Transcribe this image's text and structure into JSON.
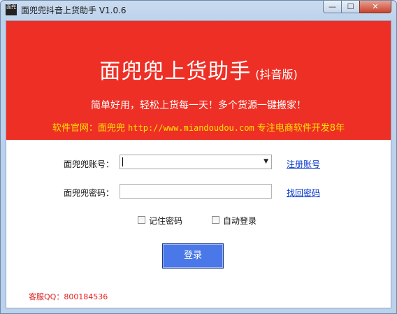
{
  "window": {
    "title": "面兜兜抖音上货助手 V1.0.6",
    "icon_text": "面兜",
    "minimize_glyph": "—",
    "maximize_glyph": "☐",
    "close_glyph": "✕"
  },
  "banner": {
    "title": "面兜兜上货助手",
    "subtitle": "(抖音版)",
    "slogan": "简单好用，轻松上货每一天！多个货源一键搬家！",
    "website_prefix": "软件官网：面兜兜 ",
    "website_url": "http://www.miandoudou.com",
    "website_suffix": " 专注电商软件开发8年"
  },
  "form": {
    "account_label": "面兜兜账号：",
    "account_value": "",
    "password_label": "面兜兜密码：",
    "password_value": "",
    "register_link": "注册账号",
    "recover_link": "找回密码",
    "remember_label": "记住密码",
    "remember_checked": false,
    "autologin_label": "自动登录",
    "autologin_checked": false,
    "login_button": "登录"
  },
  "footer": {
    "service": "客服QQ：800184536"
  },
  "colors": {
    "banner_bg": "#ee2f25",
    "website_text": "#ffe400",
    "login_button": "#4a78e8",
    "link": "#0033cc",
    "service_text": "#e02020"
  }
}
